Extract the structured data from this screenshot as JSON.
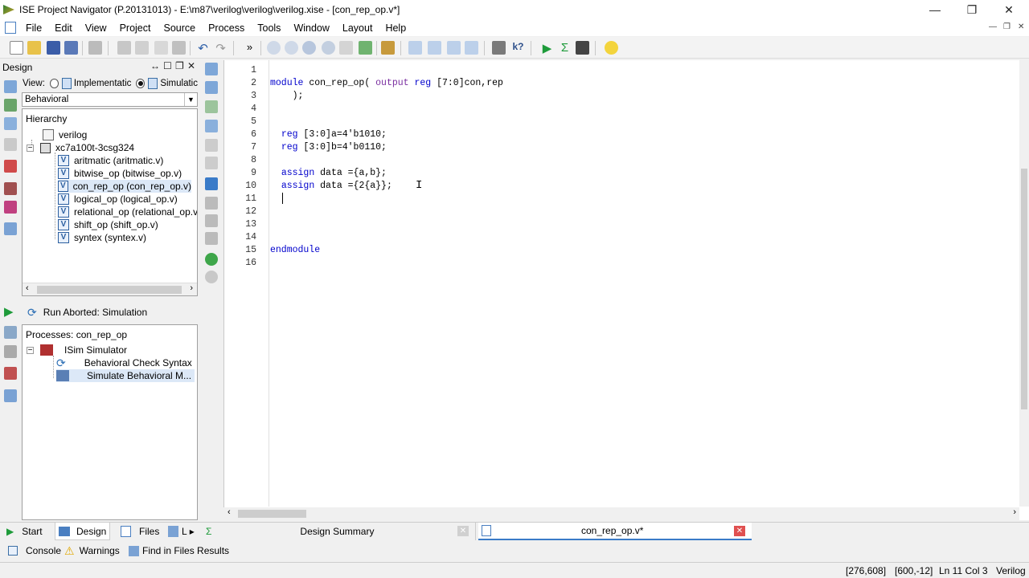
{
  "window": {
    "title": "ISE Project Navigator (P.20131013) - E:\\m87\\verilog\\verilog\\verilog.xise - [con_rep_op.v*]",
    "controls": [
      "—",
      "❐",
      "✕"
    ]
  },
  "menu": [
    "File",
    "Edit",
    "View",
    "Project",
    "Source",
    "Process",
    "Tools",
    "Window",
    "Layout",
    "Help"
  ],
  "design_panel": {
    "header": "Design",
    "view_label": "View:",
    "view_options": [
      "Implementatic",
      "Simulatic"
    ],
    "selected_view": "Simulation",
    "behavior_select": "Behavioral",
    "hierarchy_title": "Hierarchy",
    "tree": [
      {
        "label": "verilog",
        "icon": "project-icon",
        "level": 1
      },
      {
        "label": "xc7a100t-3csg324",
        "icon": "chip-icon",
        "level": 1
      },
      {
        "label": "aritmatic (aritmatic.v)",
        "icon": "verilog-file-icon",
        "level": 2
      },
      {
        "label": "bitwise_op (bitwise_op.v)",
        "icon": "verilog-file-icon",
        "level": 2
      },
      {
        "label": "con_rep_op (con_rep_op.v)",
        "icon": "verilog-file-icon",
        "level": 2,
        "selected": true
      },
      {
        "label": "logical_op (logical_op.v)",
        "icon": "verilog-file-icon",
        "level": 2
      },
      {
        "label": "relational_op (relational_op.v)",
        "icon": "verilog-file-icon",
        "level": 2
      },
      {
        "label": "shift_op (shift_op.v)",
        "icon": "verilog-file-icon",
        "level": 2
      },
      {
        "label": "syntex (syntex.v)",
        "icon": "verilog-file-icon",
        "level": 2
      }
    ],
    "run_status": "Run Aborted: Simulation",
    "processes_title": "Processes: con_rep_op",
    "processes": [
      {
        "label": "ISim Simulator",
        "level": 1
      },
      {
        "label": "Behavioral Check Syntax",
        "level": 2
      },
      {
        "label": "Simulate Behavioral M...",
        "level": 2
      }
    ]
  },
  "editor": {
    "lines": [
      {
        "n": "1",
        "code": ""
      },
      {
        "n": "2",
        "code": "module con_rep_op( output reg [7:0]con,rep"
      },
      {
        "n": "3",
        "code": "    );"
      },
      {
        "n": "4",
        "code": ""
      },
      {
        "n": "5",
        "code": ""
      },
      {
        "n": "6",
        "code": "  reg [3:0]a=4'b1010;"
      },
      {
        "n": "7",
        "code": "  reg [3:0]b=4'b0110;"
      },
      {
        "n": "8",
        "code": ""
      },
      {
        "n": "9",
        "code": "  assign data ={a,b};"
      },
      {
        "n": "10",
        "code": "  assign data ={2{a}};"
      },
      {
        "n": "11",
        "code": "  "
      },
      {
        "n": "12",
        "code": ""
      },
      {
        "n": "13",
        "code": ""
      },
      {
        "n": "14",
        "code": ""
      },
      {
        "n": "15",
        "code": "endmodule"
      },
      {
        "n": "16",
        "code": ""
      }
    ]
  },
  "bottom_tabs": {
    "left": [
      "Start",
      "Design",
      "Files",
      "L"
    ],
    "docs": [
      "Design Summary",
      "con_rep_op.v*"
    ]
  },
  "console_tabs": [
    "Console",
    "Warnings",
    "Find in Files Results"
  ],
  "status": {
    "coords1": "[276,608]",
    "coords2": "[600,-12]",
    "position": "Ln 11 Col 3",
    "language": "Verilog"
  }
}
